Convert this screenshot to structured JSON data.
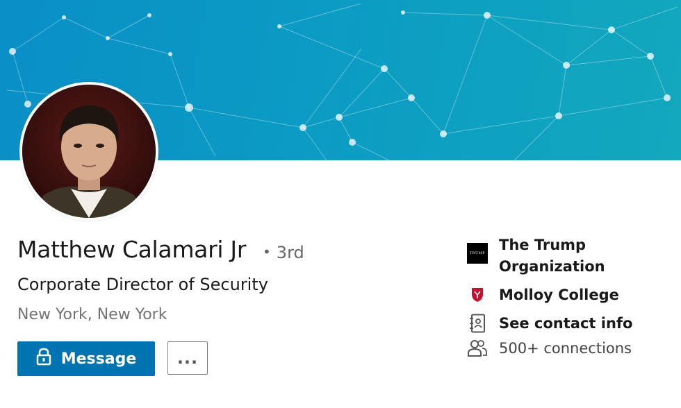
{
  "profile": {
    "name": "Matthew Calamari Jr",
    "degree": "3rd",
    "headline": "Corporate Director of Security",
    "location": "New York, New York"
  },
  "actions": {
    "message_label": "Message",
    "more_label": "..."
  },
  "sidebar": {
    "company_line1": "The Trump",
    "company_line2": "Organization",
    "company_logo_text": "TRUMP",
    "school": "Molloy College",
    "contact": "See contact info",
    "connections": "500+ connections"
  },
  "colors": {
    "banner_start": "#0a8fc6",
    "banner_end": "#12a8bd",
    "primary_button": "#0073b1",
    "school_crest": "#c8102e"
  }
}
